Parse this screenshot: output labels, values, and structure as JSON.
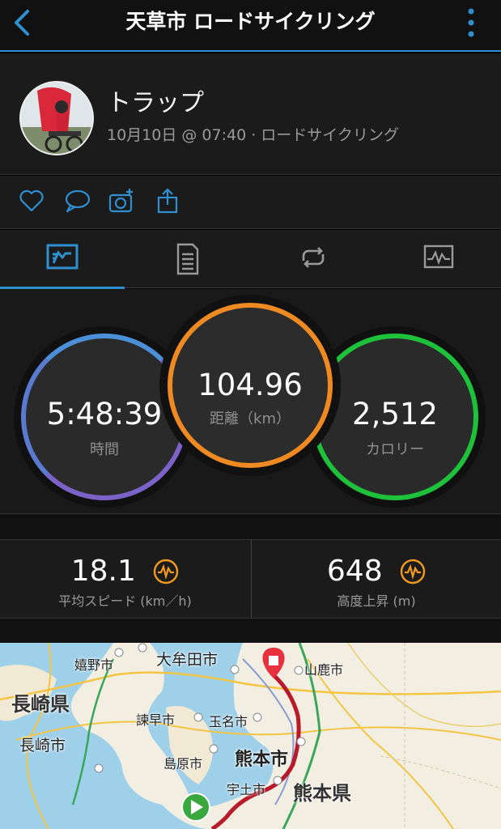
{
  "header": {
    "title": "天草市 ロードサイクリング",
    "back_icon": "chevron-left-icon",
    "menu_icon": "kebab-icon",
    "accent": "#2f8fd0"
  },
  "profile": {
    "name": "トラップ",
    "subtitle": "10月10日 @ 07:40 · ロードサイクリング"
  },
  "actions": [
    "heart-icon",
    "comment-icon",
    "add-photo-icon",
    "share-icon"
  ],
  "tabs": [
    {
      "icon": "summary-icon",
      "active": true
    },
    {
      "icon": "details-icon",
      "active": false
    },
    {
      "icon": "laps-icon",
      "active": false
    },
    {
      "icon": "charts-icon",
      "active": false
    }
  ],
  "stats": {
    "time": {
      "value": "5:48:39",
      "label": "時間"
    },
    "distance": {
      "value": "104.96",
      "label": "距離（km）"
    },
    "calories": {
      "value": "2,512",
      "label": "カロリー"
    }
  },
  "metrics": [
    {
      "value": "18.1",
      "label": "平均スピード (km／h)"
    },
    {
      "value": "648",
      "label": "高度上昇 (m)"
    }
  ],
  "map": {
    "labels": {
      "ureshino": "嬉野市",
      "omuta": "大牟田市",
      "yamaga": "山鹿市",
      "nagasaki_pref": "長崎県",
      "isahaya": "諫早市",
      "tamana": "玉名市",
      "nagasaki_city": "長崎市",
      "shimabara": "島原市",
      "kumamoto_city": "熊本市",
      "uto": "宇土市",
      "kumamoto_pref": "熊本県"
    }
  }
}
